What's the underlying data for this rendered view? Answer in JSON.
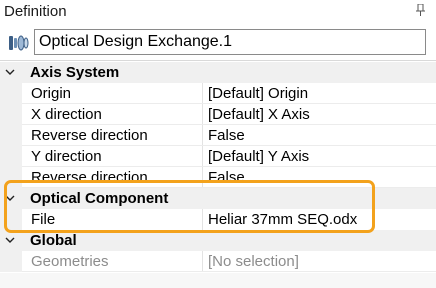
{
  "panel": {
    "title": "Definition",
    "pin_icon": "pin-icon"
  },
  "feature": {
    "icon": "optical-design-exchange-icon",
    "name": "Optical Design Exchange.1"
  },
  "categories": {
    "axis_system": {
      "label": "Axis System",
      "expanded": true,
      "properties": [
        {
          "name": "Origin",
          "value": "[Default] Origin"
        },
        {
          "name": "X direction",
          "value": "[Default] X Axis"
        },
        {
          "name": "Reverse direction",
          "value": "False"
        },
        {
          "name": "Y direction",
          "value": "[Default] Y Axis"
        },
        {
          "name": "Reverse direction",
          "value": "False"
        }
      ]
    },
    "optical_component": {
      "label": "Optical Component",
      "expanded": true,
      "properties": [
        {
          "name": "File",
          "value": "Heliar 37mm SEQ.odx"
        }
      ]
    },
    "global": {
      "label": "Global",
      "expanded": true,
      "properties": [
        {
          "name": "Geometries",
          "value": "[No selection]",
          "disabled": true
        }
      ]
    }
  },
  "colors": {
    "highlight": "#f3a21c",
    "category_background": "#f0f0f0",
    "disabled_text": "#8c8c8c"
  }
}
